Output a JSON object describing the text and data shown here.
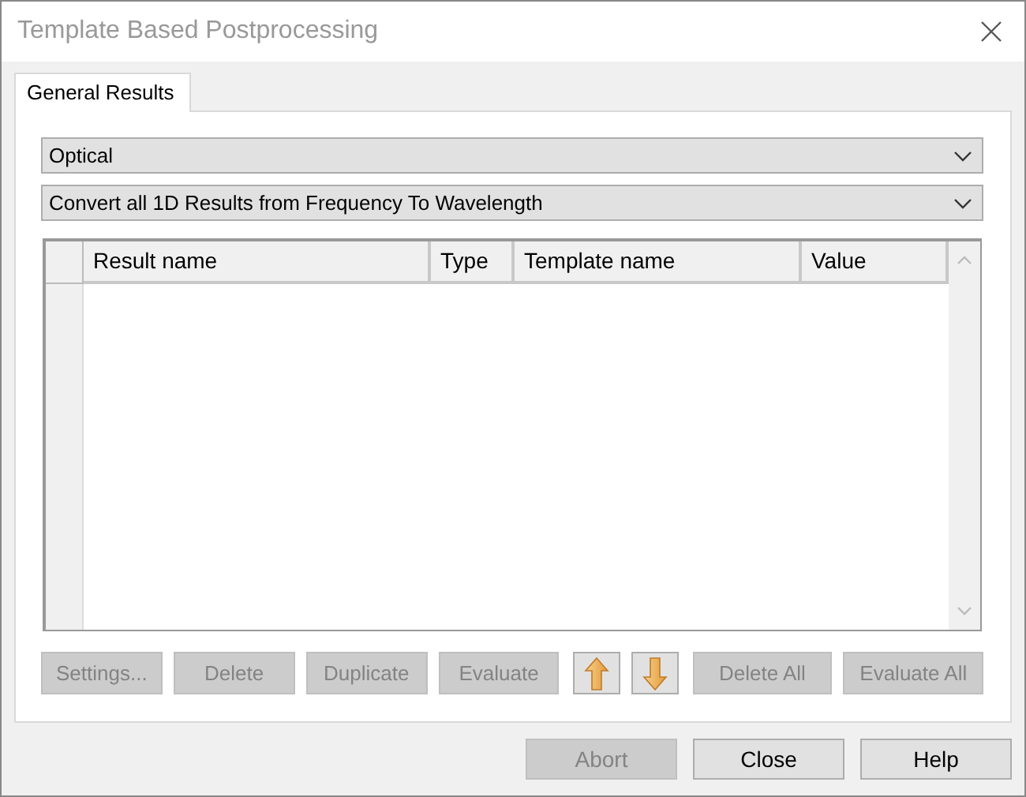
{
  "window": {
    "title": "Template Based Postprocessing"
  },
  "tabs": [
    {
      "label": "General Results",
      "selected": true
    }
  ],
  "dropdowns": [
    {
      "value": "Optical"
    },
    {
      "value": "Convert all 1D Results from Frequency To Wavelength"
    }
  ],
  "table": {
    "columns": [
      "Result name",
      "Type",
      "Template name",
      "Value"
    ]
  },
  "actions": [
    {
      "kind": "text",
      "label": "Settings...",
      "disabled": true
    },
    {
      "kind": "text",
      "label": "Delete",
      "disabled": true
    },
    {
      "kind": "text",
      "label": "Duplicate",
      "disabled": true
    },
    {
      "kind": "text",
      "label": "Evaluate",
      "disabled": true
    },
    {
      "kind": "up",
      "disabled": false
    },
    {
      "kind": "down",
      "disabled": false
    },
    {
      "kind": "text",
      "label": "Delete All",
      "disabled": true
    },
    {
      "kind": "text",
      "label": "Evaluate All",
      "disabled": true
    }
  ],
  "footer_buttons": [
    {
      "label": "Abort",
      "disabled": true
    },
    {
      "label": "Close",
      "disabled": false
    },
    {
      "label": "Help",
      "disabled": false
    }
  ]
}
